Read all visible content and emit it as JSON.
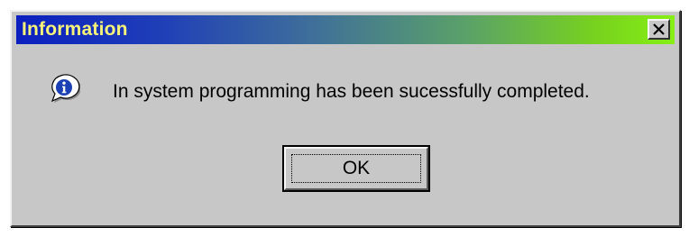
{
  "window": {
    "title": "Information",
    "close_icon": "close-icon"
  },
  "content": {
    "icon": "information-icon",
    "message": "In system programming has been sucessfully completed."
  },
  "buttons": {
    "ok_label": "OK"
  },
  "colors": {
    "dialog_background": "#c7c7c7",
    "title_gradient_start": "#0b1fbf",
    "title_gradient_end": "#86ef14",
    "title_text": "#f7f27a",
    "icon_blue": "#1b3fb5"
  }
}
